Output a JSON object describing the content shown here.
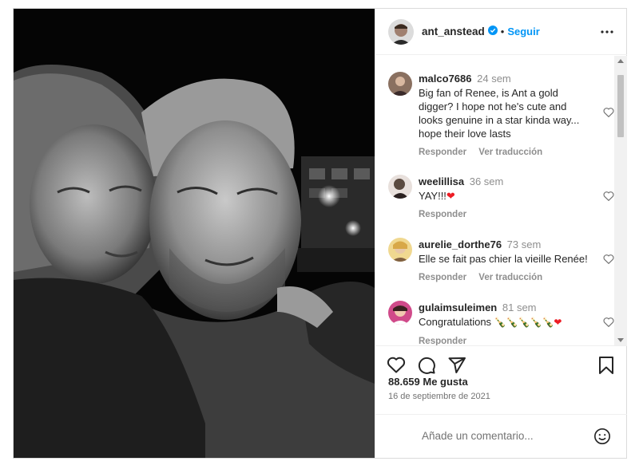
{
  "post": {
    "author": "ant_anstead",
    "follow_label": "Seguir",
    "separator": "•",
    "likes": "88.659 Me gusta",
    "date": "16 de septiembre de 2021",
    "add_comment_placeholder": "Añade un comentario..."
  },
  "comment_actions": {
    "reply": "Responder",
    "translate": "Ver traducción"
  },
  "comments": [
    {
      "user": "malco7686",
      "time": "24 sem",
      "text": "Big fan of Renee, is Ant a gold digger? I hope not he's cute and looks genuine in a star kinda way... hope their love lasts",
      "show_translate": true
    },
    {
      "user": "weelillisa",
      "time": "36 sem",
      "text": "YAY!!!",
      "emoji_suffix": "❤"
    },
    {
      "user": "aurelie_dorthe76",
      "time": "73 sem",
      "text": "Elle se fait pas chier la vieille Renée!",
      "show_translate": true
    },
    {
      "user": "gulaimsuleimen",
      "time": "81 sem",
      "text": "Congratulations",
      "emoji_suffix": "🍾🍾🍾🍾🍾❤"
    }
  ],
  "colors": {
    "accent": "#0095f6",
    "heart": "#ed1c24",
    "muted": "#8e8e8e"
  },
  "icons": [
    "verified-icon",
    "more-icon",
    "heart-icon",
    "comment-icon",
    "share-icon",
    "bookmark-icon",
    "emoji-icon"
  ]
}
